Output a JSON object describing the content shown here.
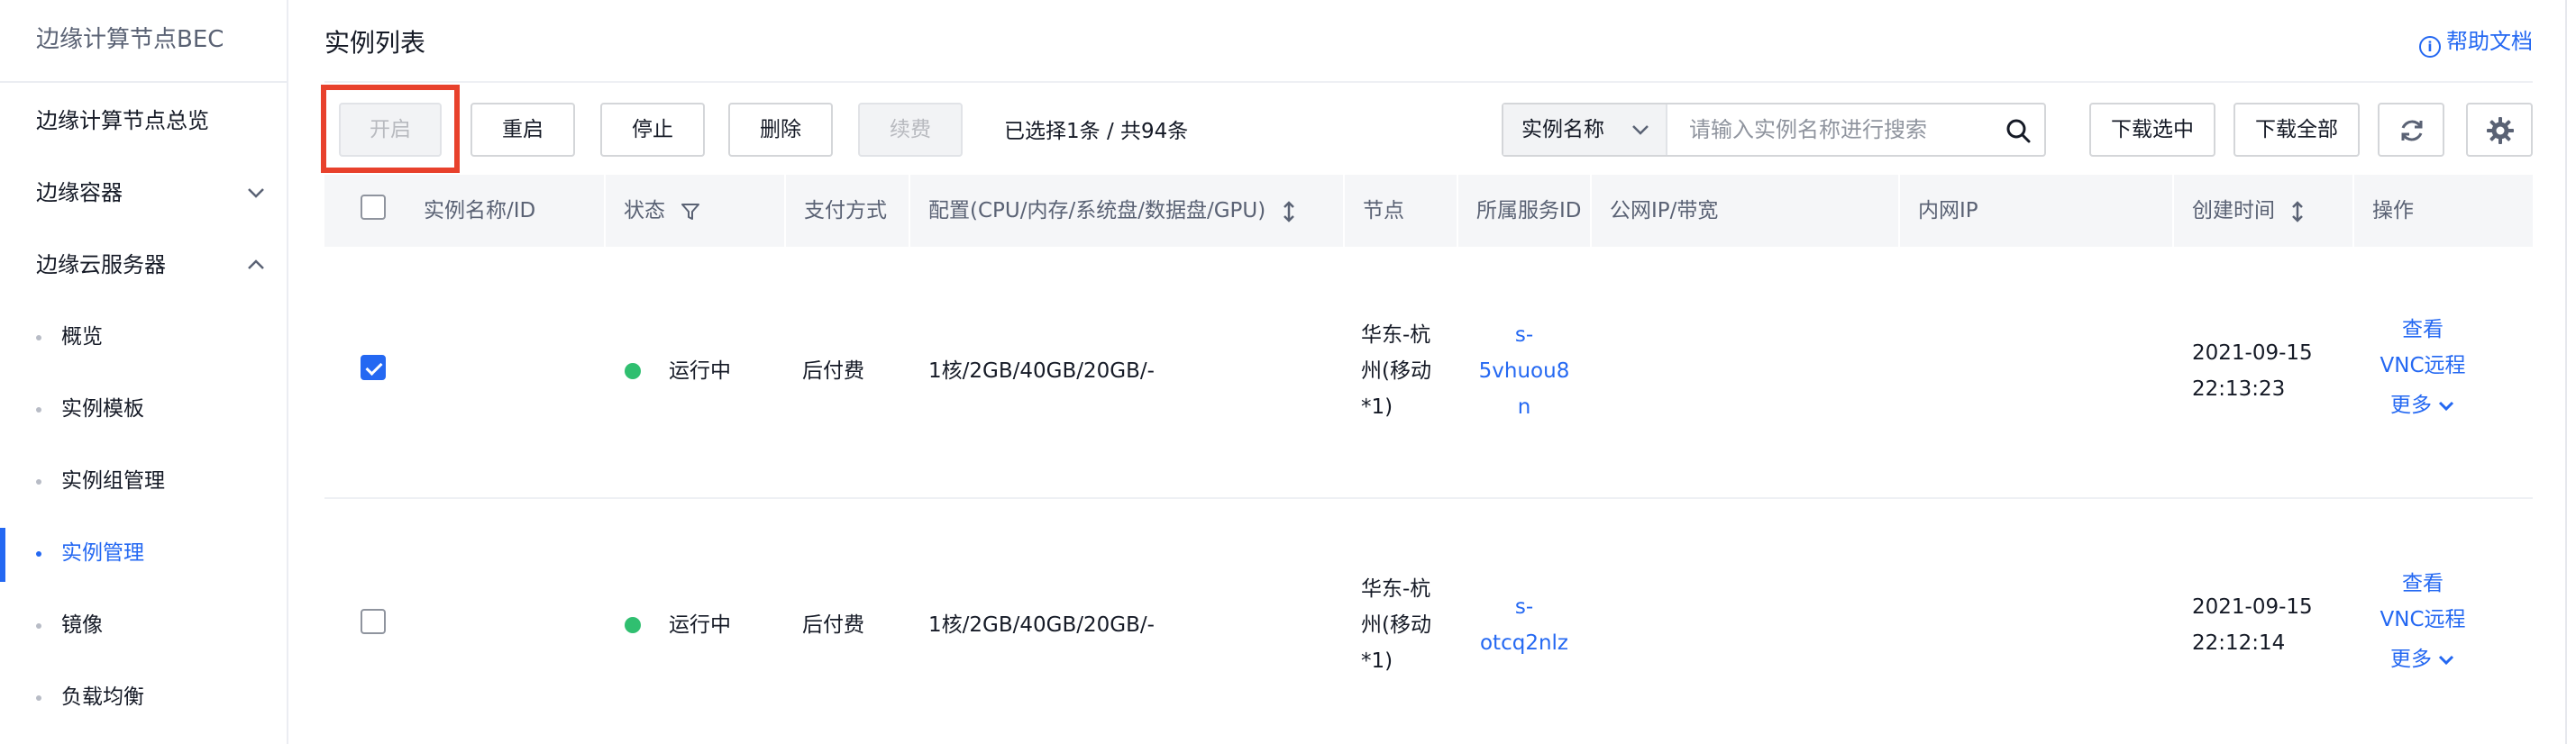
{
  "sidebar": {
    "title": "边缘计算节点BEC",
    "items": [
      {
        "label": "边缘计算节点总览"
      },
      {
        "label": "边缘容器"
      },
      {
        "label": "边缘云服务器"
      }
    ],
    "sub_items": [
      {
        "label": "概览"
      },
      {
        "label": "实例模板"
      },
      {
        "label": "实例组管理"
      },
      {
        "label": "实例管理"
      },
      {
        "label": "镜像"
      },
      {
        "label": "负载均衡"
      }
    ]
  },
  "header": {
    "title": "实例列表",
    "help_label": "帮助文档"
  },
  "toolbar": {
    "start_label": "开启",
    "restart_label": "重启",
    "stop_label": "停止",
    "delete_label": "删除",
    "renew_label": "续费",
    "selected_info": "已选择1条 / 共94条",
    "search_select": "实例名称",
    "search_placeholder": "请输入实例名称进行搜索",
    "download_selected": "下载选中",
    "download_all": "下载全部"
  },
  "table": {
    "columns": {
      "name": "实例名称/ID",
      "status": "状态",
      "payment": "支付方式",
      "config": "配置(CPU/内存/系统盘/数据盘/GPU)",
      "node": "节点",
      "service": "所属服务ID",
      "public_ip": "公网IP/带宽",
      "private_ip": "内网IP",
      "created": "创建时间",
      "ops": "操作"
    },
    "rows": [
      {
        "checked": true,
        "status": "运行中",
        "payment": "后付费",
        "config": "1核/2GB/40GB/20GB/-",
        "node": [
          "华东-杭",
          "州(移动",
          "*1)"
        ],
        "service": [
          "s-",
          "5vhuou8",
          "n"
        ],
        "created": [
          "2021-09-15",
          "22:13:23"
        ],
        "op_view": "查看",
        "op_vnc": "VNC远程",
        "op_more": "更多"
      },
      {
        "checked": false,
        "status": "运行中",
        "payment": "后付费",
        "config": "1核/2GB/40GB/20GB/-",
        "node": [
          "华东-杭",
          "州(移动",
          "*1)"
        ],
        "service": [
          "s-",
          "otcq2nlz"
        ],
        "created": [
          "2021-09-15",
          "22:12:14"
        ],
        "op_view": "查看",
        "op_vnc": "VNC远程",
        "op_more": "更多"
      }
    ]
  },
  "colors": {
    "accent": "#2468f2",
    "running": "#30bf70",
    "highlight": "#e8412c"
  }
}
